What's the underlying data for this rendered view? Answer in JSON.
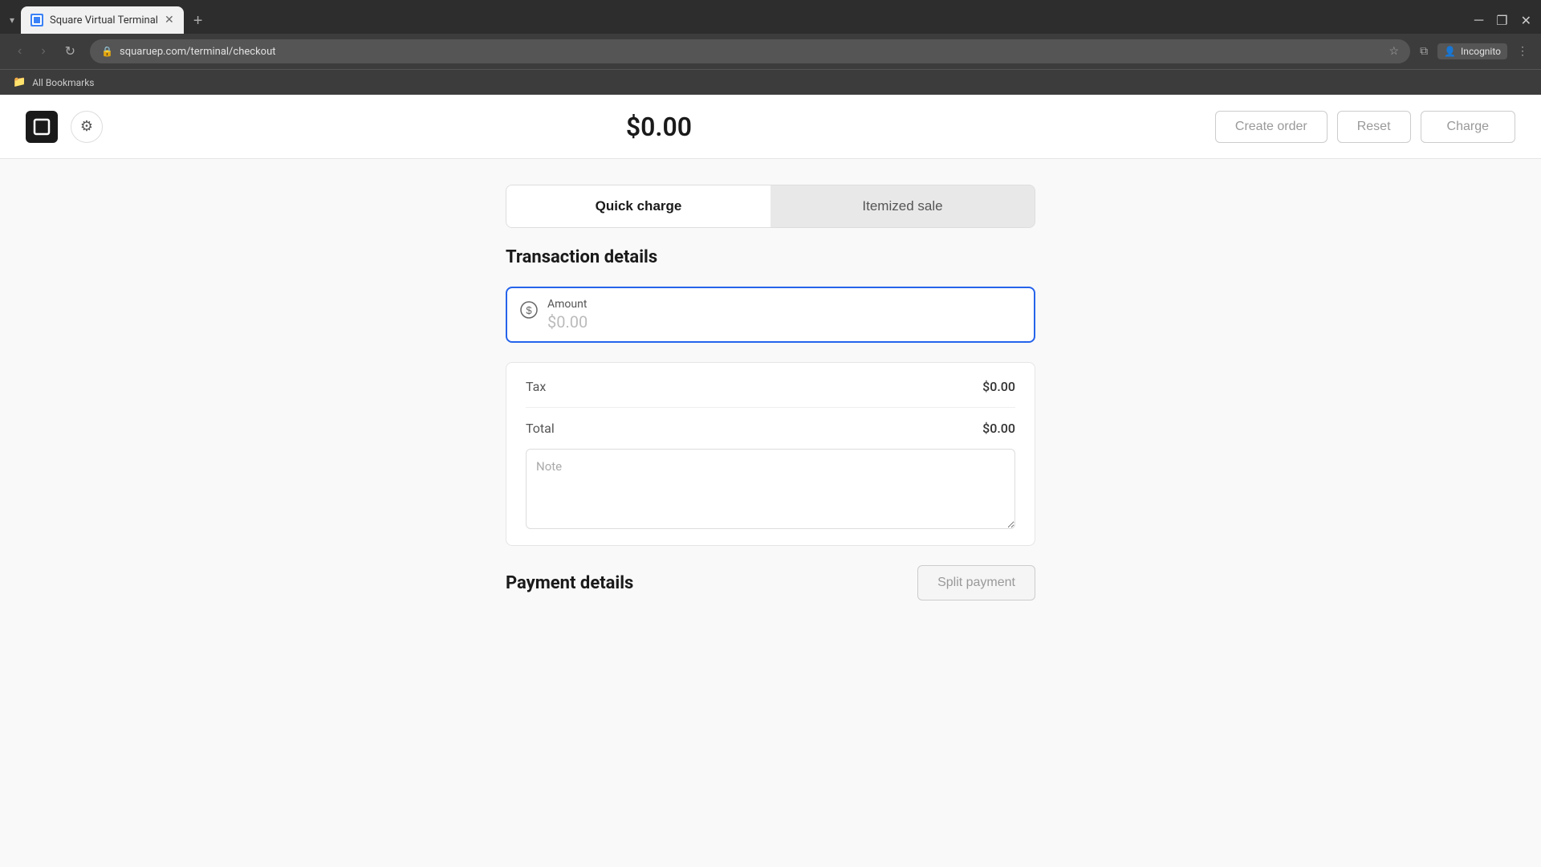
{
  "browser": {
    "tab": {
      "favicon_text": "S",
      "title": "Square Virtual Terminal"
    },
    "url": "squaruep.com/terminal/checkout",
    "url_display": "squaruep.com/terminal/checkout",
    "back_disabled": true,
    "forward_disabled": true,
    "incognito_label": "Incognito",
    "bookmarks_label": "All Bookmarks"
  },
  "header": {
    "amount": "$0.00",
    "create_order_label": "Create order",
    "reset_label": "Reset",
    "charge_label": "Charge"
  },
  "tabs": {
    "quick_charge_label": "Quick charge",
    "itemized_sale_label": "Itemized sale",
    "active": "quick_charge"
  },
  "transaction_details": {
    "section_title": "Transaction details",
    "amount_label": "Amount",
    "amount_placeholder": "$0.00",
    "tax_label": "Tax",
    "tax_value": "$0.00",
    "total_label": "Total",
    "total_value": "$0.00",
    "note_placeholder": "Note"
  },
  "payment_details": {
    "section_title": "Payment details",
    "split_payment_label": "Split payment"
  }
}
